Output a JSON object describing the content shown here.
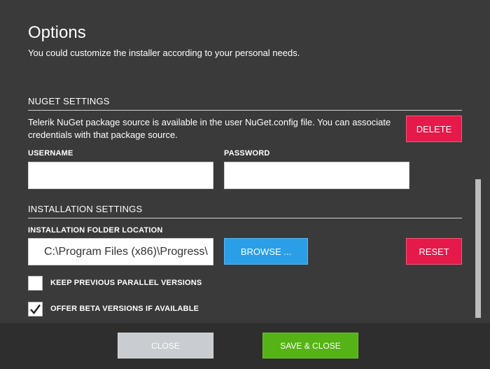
{
  "header": {
    "title": "Options",
    "subtitle": "You could customize the installer according to your personal needs."
  },
  "nuget": {
    "section_title": "NUGET SETTINGS",
    "description": "Telerik NuGet package source is available in the user NuGet.config file. You can associate credentials with that package source.",
    "delete_label": "DELETE",
    "username_label": "USERNAME",
    "username_value": "",
    "password_label": "PASSWORD",
    "password_value": ""
  },
  "installation": {
    "section_title": "INSTALLATION SETTINGS",
    "folder_label": "INSTALLATION FOLDER LOCATION",
    "folder_value": "C:\\Program Files (x86)\\Progress\\",
    "browse_label": "BROWSE ...",
    "reset_label": "RESET",
    "keep_previous_label": "KEEP PREVIOUS PARALLEL VERSIONS",
    "keep_previous_checked": false,
    "offer_beta_label": "OFFER BETA VERSIONS IF AVAILABLE",
    "offer_beta_checked": true
  },
  "footer": {
    "close_label": "CLOSE",
    "save_close_label": "SAVE & CLOSE"
  },
  "colors": {
    "background": "#3a3a3a",
    "footer_background": "#2e2e2e",
    "danger": "#e5194a",
    "primary": "#2a9fe8",
    "success": "#55b316",
    "disabled": "#c9ccd0"
  }
}
